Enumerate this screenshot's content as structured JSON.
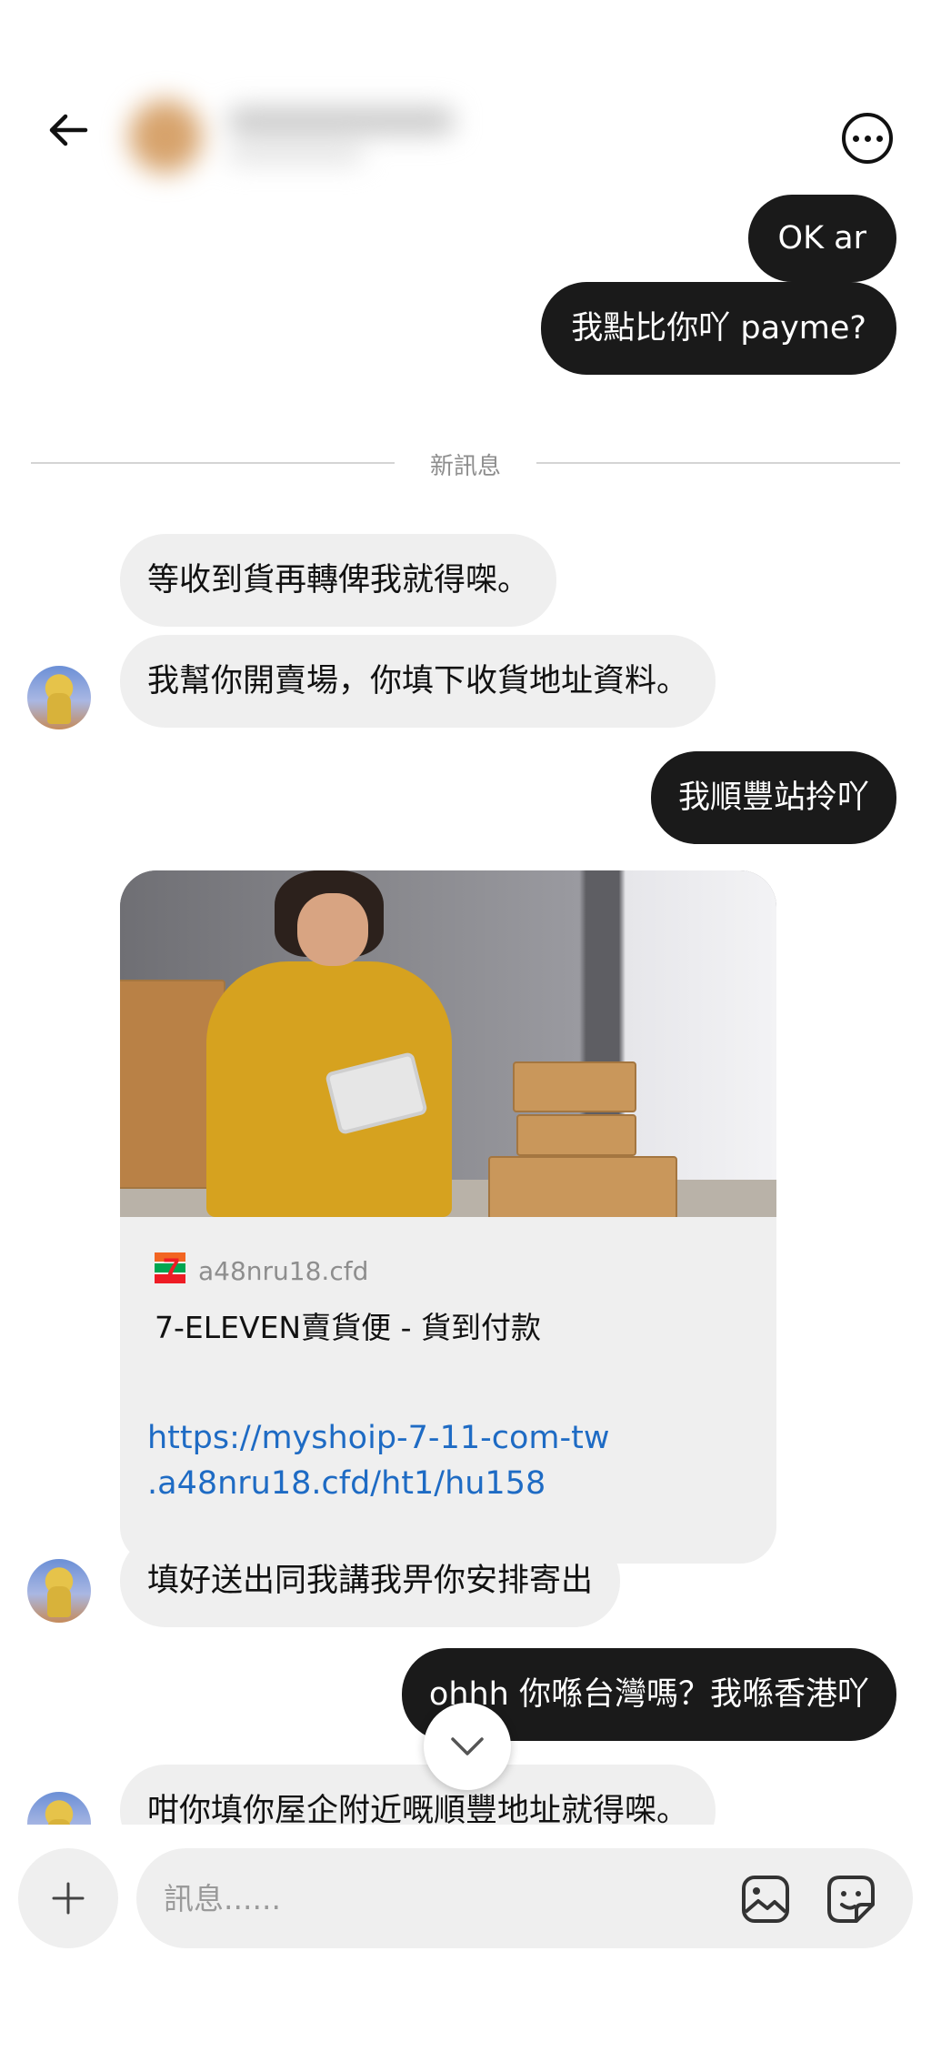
{
  "header": {
    "back_icon": "arrow-left-icon",
    "more_icon": "more-horizontal-icon"
  },
  "divider": {
    "label": "新訊息"
  },
  "messages": [
    {
      "from": "me",
      "text": "OK ar"
    },
    {
      "from": "me",
      "text": "我點比你吖 payme?"
    },
    {
      "from": "them",
      "text": "等收到貨再轉俾我就得㗎。"
    },
    {
      "from": "them",
      "text": "我幫你開賣場，你填下收貨地址資料。"
    },
    {
      "from": "me",
      "text": "我順豐站拎吖"
    },
    {
      "from": "them",
      "text": "填好送出同我講我畀你安排寄出"
    },
    {
      "from": "me",
      "text": "ohhh 你喺台灣嗎？我喺香港吖"
    },
    {
      "from": "them",
      "text": "咁你填你屋企附近嘅順豐地址就得㗎。"
    }
  ],
  "link_card": {
    "site": "a48nru18.cfd",
    "title": "7-ELEVEN賣貨便 - 貨到付款",
    "logo": "7-eleven-logo"
  },
  "link_url": {
    "line1": "https://myshoip-7-11-com-tw",
    "line2": ".a48nru18.cfd/ht1/hu158"
  },
  "composer": {
    "placeholder": "訊息......",
    "plus_icon": "plus-icon",
    "image_icon": "image-icon",
    "sticker_icon": "sticker-icon"
  },
  "colors": {
    "outgoing_bubble": "#1a1a1a",
    "incoming_bubble": "#efefef",
    "link": "#1e6bc4"
  }
}
